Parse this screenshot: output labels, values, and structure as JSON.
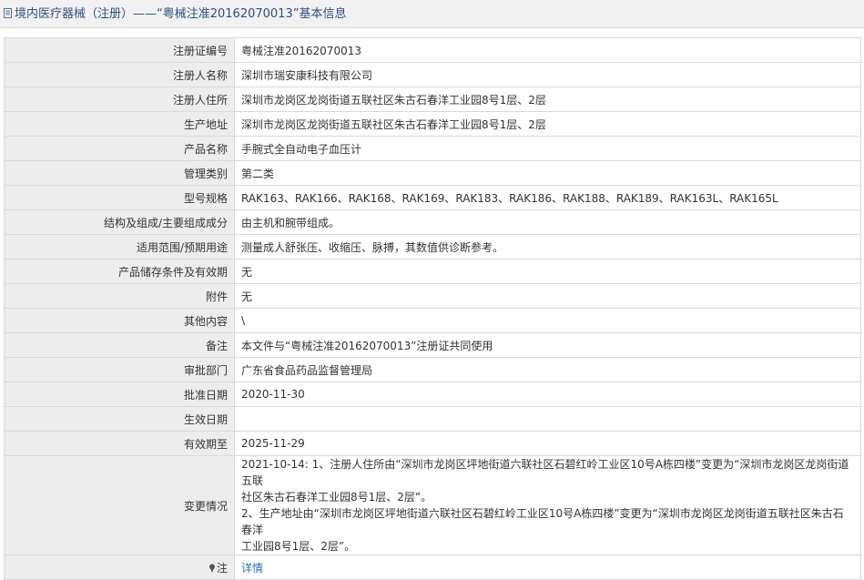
{
  "header": {
    "title": "境内医疗器械（注册）——“粤械注准20162070013”基本信息"
  },
  "rows": [
    {
      "label": "注册证编号",
      "value": "粤械注准20162070013"
    },
    {
      "label": "注册人名称",
      "value": "深圳市瑞安康科技有限公司"
    },
    {
      "label": "注册人住所",
      "value": "深圳市龙岗区龙岗街道五联社区朱古石春洋工业园8号1层、2层"
    },
    {
      "label": "生产地址",
      "value": "深圳市龙岗区龙岗街道五联社区朱古石春洋工业园8号1层、2层"
    },
    {
      "label": "产品名称",
      "value": "手腕式全自动电子血压计"
    },
    {
      "label": "管理类别",
      "value": "第二类"
    },
    {
      "label": "型号规格",
      "value": "RAK163、RAK166、RAK168、RAK169、RAK183、RAK186、RAK188、RAK189、RAK163L、RAK165L"
    },
    {
      "label": "结构及组成/主要组成成分",
      "value": "由主机和腕带组成。"
    },
    {
      "label": "适用范围/预期用途",
      "value": "测量成人舒张压、收缩压、脉搏，其数值供诊断参考。"
    },
    {
      "label": "产品储存条件及有效期",
      "value": "无"
    },
    {
      "label": "附件",
      "value": "无"
    },
    {
      "label": "其他内容",
      "value": "\\"
    },
    {
      "label": "备注",
      "value": "本文件与“粤械注准20162070013”注册证共同使用"
    },
    {
      "label": "审批部门",
      "value": "广东省食品药品监督管理局"
    },
    {
      "label": "批准日期",
      "value": "2020-11-30"
    },
    {
      "label": "生效日期",
      "value": ""
    },
    {
      "label": "有效期至",
      "value": "2025-11-29"
    }
  ],
  "changes": {
    "label": "变更情况",
    "lines": [
      "2021-10-14: 1、注册人住所由“深圳市龙岗区坪地街道六联社区石碧红岭工业区10号A栋四楼”变更为“深圳市龙岗区龙岗街道五联",
      "社区朱古石春洋工业园8号1层、2层”。",
      "2、生产地址由“深圳市龙岗区坪地街道六联社区石碧红岭工业区10号A栋四楼”变更为“深圳市龙岗区龙岗街道五联社区朱古石春洋",
      "工业园8号1层、2层”。"
    ]
  },
  "note": {
    "label": "注",
    "link_text": "详情",
    "icon": "pin-icon"
  },
  "icons": {
    "title": "document-icon"
  },
  "colors": {
    "title_text": "#2f4f7f",
    "label_bg": "#ededed",
    "border": "#d9d9d9",
    "link": "#2b6fb6"
  }
}
